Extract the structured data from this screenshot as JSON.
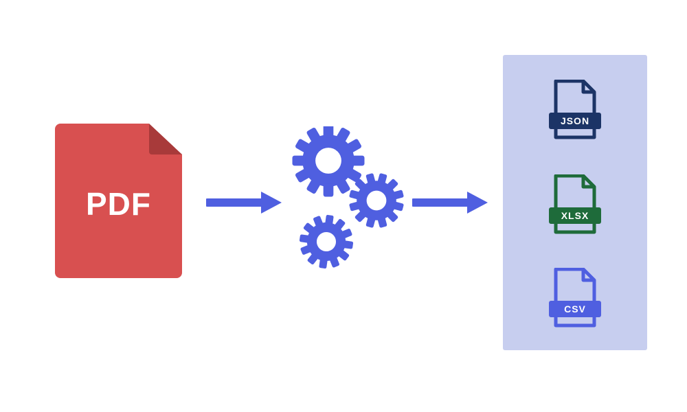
{
  "input": {
    "label": "PDF"
  },
  "outputs": {
    "json": {
      "label": "JSON"
    },
    "xlsx": {
      "label": "XLSX"
    },
    "csv": {
      "label": "CSV"
    }
  },
  "colors": {
    "pdf": "#d85050",
    "arrow": "#4f5fe0",
    "gear": "#4f5fe0",
    "panel": "#c7ceef",
    "json": "#1c3466",
    "xlsx": "#1e6b3a",
    "csv": "#4f5fe0"
  }
}
